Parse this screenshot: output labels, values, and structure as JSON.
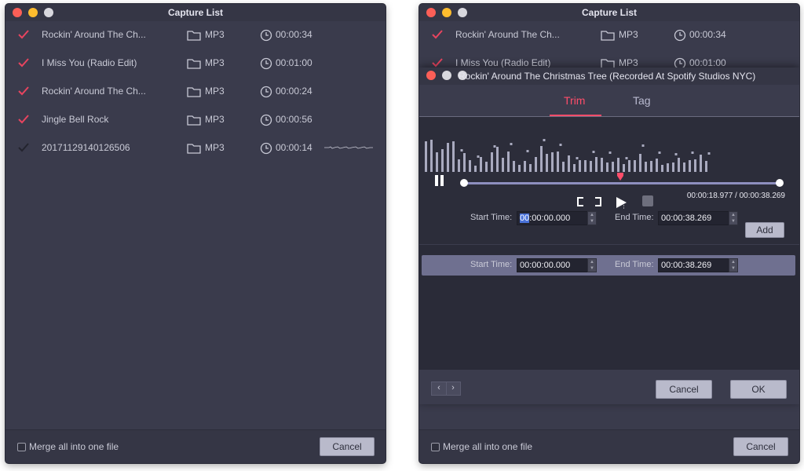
{
  "left_window": {
    "title": "Capture List",
    "rows": [
      {
        "name": "Rockin' Around The Ch...",
        "format": "MP3",
        "duration": "00:00:34",
        "status": "done"
      },
      {
        "name": "I Miss You (Radio Edit)",
        "format": "MP3",
        "duration": "00:01:00",
        "status": "done"
      },
      {
        "name": "Rockin' Around The Ch...",
        "format": "MP3",
        "duration": "00:00:24",
        "status": "done"
      },
      {
        "name": "Jingle Bell Rock",
        "format": "MP3",
        "duration": "00:00:56",
        "status": "done"
      },
      {
        "name": "20171129140126506",
        "format": "MP3",
        "duration": "00:00:14",
        "status": "recording"
      }
    ],
    "merge_label": "Merge all into one file",
    "cancel_label": "Cancel"
  },
  "right_window": {
    "title": "Capture List",
    "rows": [
      {
        "name": "Rockin' Around The Ch...",
        "format": "MP3",
        "duration": "00:00:34"
      },
      {
        "name": "I Miss You (Radio Edit)",
        "format": "MP3",
        "duration": "00:01:00"
      }
    ],
    "merge_label": "Merge all into one file",
    "cancel_label": "Cancel"
  },
  "trim_dialog": {
    "title": "Rockin' Around The Christmas Tree (Recorded At Spotify Studios NYC)",
    "tabs": [
      "Trim",
      "Tag"
    ],
    "active_tab": "Trim",
    "current_time": "00:00:18.977",
    "total_time": "00:00:38.269",
    "time_separator": "/",
    "playhead_fraction": 0.496,
    "start_label": "Start Time:",
    "end_label": "End Time:",
    "start_value_highlight": "00",
    "start_value_rest": ":00:00.000",
    "end_value": "00:00:38.269",
    "add_label": "Add",
    "segments": [
      {
        "start": "00:00:00.000",
        "end": "00:00:38.269"
      }
    ],
    "cancel_label": "Cancel",
    "ok_label": "OK"
  },
  "colors": {
    "accent": "#ff4d6a",
    "window_bg": "#3a3b4c",
    "selected_segment": "#6f7090"
  },
  "icons": [
    "check-icon",
    "folder-icon",
    "clock-icon",
    "pause-icon",
    "play-icon",
    "stop-icon",
    "bracket-icon",
    "chevron-left-icon",
    "chevron-right-icon"
  ]
}
